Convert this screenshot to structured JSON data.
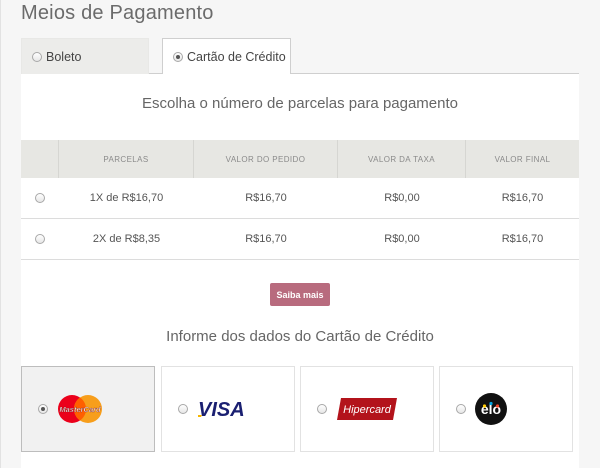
{
  "page": {
    "title": "Meios de Pagamento"
  },
  "tabs": [
    {
      "label": "Boleto",
      "selected": false
    },
    {
      "label": "Cartão de Crédito",
      "selected": true
    }
  ],
  "installments": {
    "heading": "Escolha o número de parcelas para pagamento",
    "columns": [
      "PARCELAS",
      "VALOR DO PEDIDO",
      "VALOR DA TAXA",
      "VALOR FINAL"
    ],
    "rows": [
      {
        "parcelas": "1X de R$16,70",
        "valor_pedido": "R$16,70",
        "valor_taxa": "R$0,00",
        "valor_final": "R$16,70",
        "selected": false
      },
      {
        "parcelas": "2X de R$8,35",
        "valor_pedido": "R$16,70",
        "valor_taxa": "R$0,00",
        "valor_final": "R$16,70",
        "selected": false
      }
    ]
  },
  "saiba_mais_label": "Saiba mais",
  "card_section": {
    "heading": "Informe dos dados do Cartão de Crédito",
    "brands": [
      {
        "name": "MasterCard",
        "icon": "mastercard-logo",
        "selected": true
      },
      {
        "name": "VISA",
        "icon": "visa-logo",
        "selected": false
      },
      {
        "name": "Hipercard",
        "icon": "hipercard-logo",
        "selected": false
      },
      {
        "name": "elo",
        "icon": "elo-logo",
        "selected": false
      }
    ]
  },
  "colors": {
    "accent_button": "#b86b7e",
    "table_header": "#e7e7e3",
    "visa_blue": "#1a1f71",
    "hipercard_red": "#b3131b",
    "mastercard_red": "#eb001b",
    "mastercard_yellow": "#f79e1b"
  }
}
